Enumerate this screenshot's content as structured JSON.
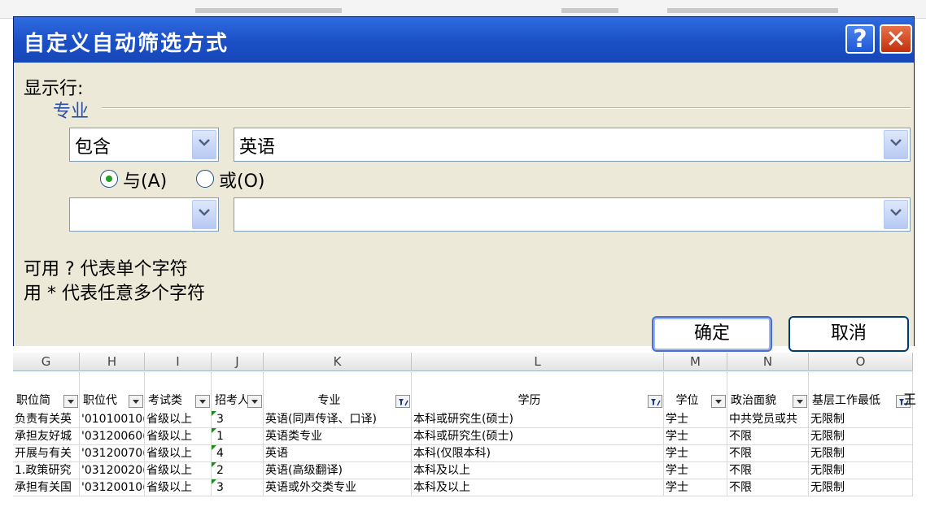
{
  "dialog": {
    "title": "自定义自动筛选方式",
    "help_icon": "?",
    "close_icon": "✕",
    "show_rows_label": "显示行:",
    "field_name": "专业",
    "condition1": {
      "operator": "包含",
      "value": "英语"
    },
    "logic": {
      "and_label": "与(A)",
      "or_label": "或(O)",
      "selected": "and"
    },
    "condition2": {
      "operator": "",
      "value": ""
    },
    "hint1": "可用 ? 代表单个字符",
    "hint2": "用 * 代表任意多个字符",
    "ok_label": "确定",
    "cancel_label": "取消"
  },
  "sheet": {
    "columns": [
      "G",
      "H",
      "I",
      "J",
      "K",
      "L",
      "M",
      "N",
      "O"
    ],
    "fields": [
      "职位简",
      "职位代",
      "考试类",
      "招考人",
      "专业",
      "学历",
      "学位",
      "政治面貌",
      "基层工作最低",
      "王"
    ],
    "rows": [
      [
        "负责有关英",
        "'01010010(",
        "省级以上",
        "3",
        "英语(同声传译、口译)",
        "本科或研究生(硕士)",
        "学士",
        "中共党员或共",
        "无限制"
      ],
      [
        "承担友好城",
        "'03120060(",
        "省级以上",
        "1",
        "英语类专业",
        "本科或研究生(硕士)",
        "学士",
        "不限",
        "无限制"
      ],
      [
        "开展与有关",
        "'03120070(",
        "省级以上",
        "4",
        "英语",
        "本科(仅限本科)",
        "学士",
        "不限",
        "无限制"
      ],
      [
        "1.政策研究",
        "'03120020(",
        "省级以上",
        "2",
        "英语(高级翻译)",
        "本科及以上",
        "学士",
        "不限",
        "无限制"
      ],
      [
        "承担有关国",
        "'03120010(",
        "省级以上",
        "3",
        "英语或外交类专业",
        "本科及以上",
        "学士",
        "不限",
        "无限制"
      ]
    ]
  }
}
